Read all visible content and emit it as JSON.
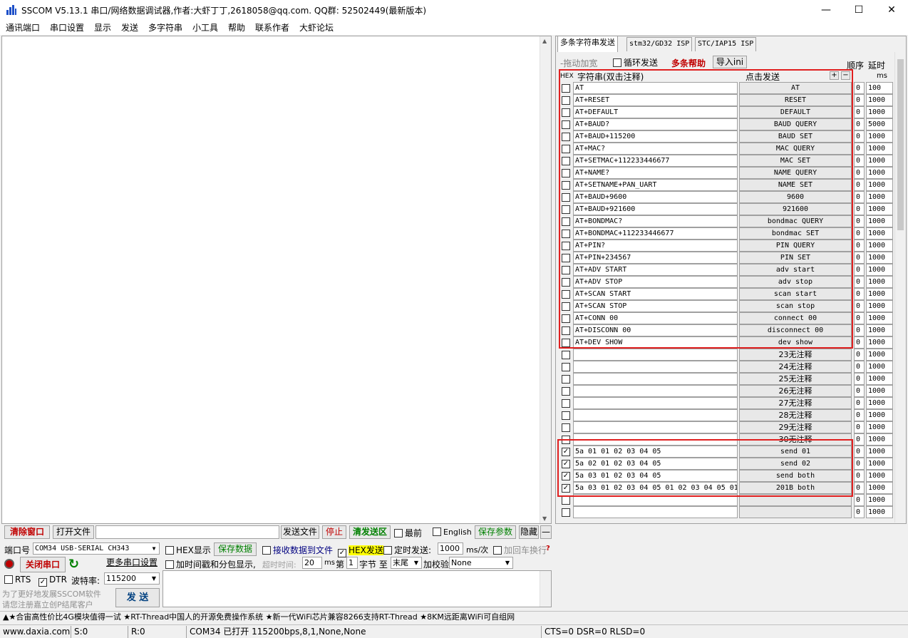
{
  "title": "SSCOM V5.13.1 串口/网络数据调试器,作者:大虾丁丁,2618058@qq.com. QQ群: 52502449(最新版本)",
  "window_controls": {
    "minimize": "—",
    "maximize": "☐",
    "close": "✕"
  },
  "menu": [
    "通讯端口",
    "串口设置",
    "显示",
    "发送",
    "多字符串",
    "小工具",
    "帮助",
    "联系作者",
    "大虾论坛"
  ],
  "tabs": [
    "多条字符串发送",
    "stm32/GD32 ISP",
    "STC/IAP15 ISP"
  ],
  "options": {
    "drag_widen": "-拖动加宽",
    "loop_send": "循环发送",
    "multi_help": "多条帮助",
    "import_ini": "导入ini",
    "order": "顺序",
    "delay": "延时"
  },
  "grid_header": {
    "hex": "HEX",
    "string": "字符串(双击注释)",
    "click_send": "点击发送",
    "plus": "+",
    "minus": "−",
    "ms": "ms"
  },
  "rows": [
    {
      "checked": false,
      "cmd": "AT",
      "btn": "AT",
      "ord": "0",
      "delay": "100"
    },
    {
      "checked": false,
      "cmd": "AT+RESET",
      "btn": "RESET",
      "ord": "0",
      "delay": "1000"
    },
    {
      "checked": false,
      "cmd": "AT+DEFAULT",
      "btn": "DEFAULT",
      "ord": "0",
      "delay": "1000"
    },
    {
      "checked": false,
      "cmd": "AT+BAUD?",
      "btn": "BAUD QUERY",
      "ord": "0",
      "delay": "5000"
    },
    {
      "checked": false,
      "cmd": "AT+BAUD+115200",
      "btn": "BAUD SET",
      "ord": "0",
      "delay": "1000"
    },
    {
      "checked": false,
      "cmd": "AT+MAC?",
      "btn": "MAC QUERY",
      "ord": "0",
      "delay": "1000"
    },
    {
      "checked": false,
      "cmd": "AT+SETMAC+112233446677",
      "btn": "MAC SET",
      "ord": "0",
      "delay": "1000"
    },
    {
      "checked": false,
      "cmd": "AT+NAME?",
      "btn": "NAME QUERY",
      "ord": "0",
      "delay": "1000"
    },
    {
      "checked": false,
      "cmd": "AT+SETNAME+PAN_UART",
      "btn": "NAME SET",
      "ord": "0",
      "delay": "1000"
    },
    {
      "checked": false,
      "cmd": "AT+BAUD+9600",
      "btn": "9600",
      "ord": "0",
      "delay": "1000"
    },
    {
      "checked": false,
      "cmd": "AT+BAUD+921600",
      "btn": "921600",
      "ord": "0",
      "delay": "1000"
    },
    {
      "checked": false,
      "cmd": "AT+BONDMAC?",
      "btn": "bondmac QUERY",
      "ord": "0",
      "delay": "1000"
    },
    {
      "checked": false,
      "cmd": "AT+BONDMAC+112233446677",
      "btn": "bondmac SET",
      "ord": "0",
      "delay": "1000"
    },
    {
      "checked": false,
      "cmd": "AT+PIN?",
      "btn": "PIN QUERY",
      "ord": "0",
      "delay": "1000"
    },
    {
      "checked": false,
      "cmd": "AT+PIN+234567",
      "btn": "PIN SET",
      "ord": "0",
      "delay": "1000"
    },
    {
      "checked": false,
      "cmd": "AT+ADV START",
      "btn": "adv start",
      "ord": "0",
      "delay": "1000"
    },
    {
      "checked": false,
      "cmd": "AT+ADV STOP",
      "btn": "adv stop",
      "ord": "0",
      "delay": "1000"
    },
    {
      "checked": false,
      "cmd": "AT+SCAN START",
      "btn": "scan start",
      "ord": "0",
      "delay": "1000"
    },
    {
      "checked": false,
      "cmd": "AT+SCAN STOP",
      "btn": "scan stop",
      "ord": "0",
      "delay": "1000"
    },
    {
      "checked": false,
      "cmd": "AT+CONN 00",
      "btn": "connect 00",
      "ord": "0",
      "delay": "1000"
    },
    {
      "checked": false,
      "cmd": "AT+DISCONN 00",
      "btn": "disconnect 00",
      "ord": "0",
      "delay": "1000"
    },
    {
      "checked": false,
      "cmd": "AT+DEV SHOW",
      "btn": "dev show",
      "ord": "0",
      "delay": "1000"
    },
    {
      "checked": false,
      "cmd": "",
      "btn": "23无注释",
      "ord": "0",
      "delay": "1000"
    },
    {
      "checked": false,
      "cmd": "",
      "btn": "24无注释",
      "ord": "0",
      "delay": "1000"
    },
    {
      "checked": false,
      "cmd": "",
      "btn": "25无注释",
      "ord": "0",
      "delay": "1000"
    },
    {
      "checked": false,
      "cmd": "",
      "btn": "26无注释",
      "ord": "0",
      "delay": "1000"
    },
    {
      "checked": false,
      "cmd": "",
      "btn": "27无注释",
      "ord": "0",
      "delay": "1000"
    },
    {
      "checked": false,
      "cmd": "",
      "btn": "28无注释",
      "ord": "0",
      "delay": "1000"
    },
    {
      "checked": false,
      "cmd": "",
      "btn": "29无注释",
      "ord": "0",
      "delay": "1000"
    },
    {
      "checked": false,
      "cmd": "",
      "btn": "30无注释",
      "ord": "0",
      "delay": "1000"
    },
    {
      "checked": true,
      "cmd": "5a 01 01 02 03 04 05",
      "btn": "send 01",
      "ord": "0",
      "delay": "1000"
    },
    {
      "checked": true,
      "cmd": "5a 02 01 02 03 04 05",
      "btn": "send 02",
      "ord": "0",
      "delay": "1000"
    },
    {
      "checked": true,
      "cmd": "5a 03 01 02 03 04 05",
      "btn": "send both",
      "ord": "0",
      "delay": "1000"
    },
    {
      "checked": true,
      "cmd": "5a 03 01 02 03 04 05 01 02 03 04 05 01",
      "btn": "201B both",
      "ord": "0",
      "delay": "1000"
    },
    {
      "checked": false,
      "cmd": "",
      "btn": "",
      "ord": "0",
      "delay": "1000"
    },
    {
      "checked": false,
      "cmd": "",
      "btn": "",
      "ord": "0",
      "delay": "1000"
    }
  ],
  "bottom": {
    "clear_window": "清除窗口",
    "open_file": "打开文件",
    "send_file": "发送文件",
    "stop": "停止",
    "clear_send": "清发送区",
    "topmost": "最前",
    "english": "English",
    "save_params": "保存参数",
    "hide": "隐藏",
    "dash": "—",
    "port_label": "端口号",
    "port_value": "COM34 USB-SERIAL CH343",
    "hex_display": "HEX显示",
    "save_data": "保存数据",
    "recv_to_file": "接收数据到文件",
    "hex_send": "HEX发送",
    "timed_send": "定时发送:",
    "timed_value": "1000",
    "ms_per": "ms/次",
    "add_crlf": "加回车换行",
    "close_port": "关闭串口",
    "more_settings": "更多串口设置",
    "timestamp": "加时间戳和分包显示,",
    "timeout_label": "超时时间:",
    "timeout_value": "20",
    "ms": "ms",
    "nth": "第",
    "nth_value": "1",
    "byte_to": "字节 至",
    "end_value": "末尾",
    "checksum": "加校验",
    "checksum_value": "None",
    "rts": "RTS",
    "dtr": "DTR",
    "baud_label": "波特率:",
    "baud_value": "115200",
    "promo1": "为了更好地发展SSCOM软件",
    "promo2": "请您注册嘉立创P结尾客户",
    "send": "发 送"
  },
  "ticker": "▲★合宙高性价比4G模块值得一试 ★RT-Thread中国人的开源免费操作系统 ★新一代WiFi芯片兼容8266支持RT-Thread ★8KM远距离WiFi可自组网",
  "status": {
    "site": "www.daxia.com",
    "s": "S:0",
    "r": "R:0",
    "port": "COM34 已打开  115200bps,8,1,None,None",
    "lines": "CTS=0 DSR=0 RLSD=0"
  },
  "colors": {
    "accent_red": "#c00000",
    "highlight_box": "#e02020",
    "green": "#008000",
    "hex_send_bg": "#ffff00"
  }
}
